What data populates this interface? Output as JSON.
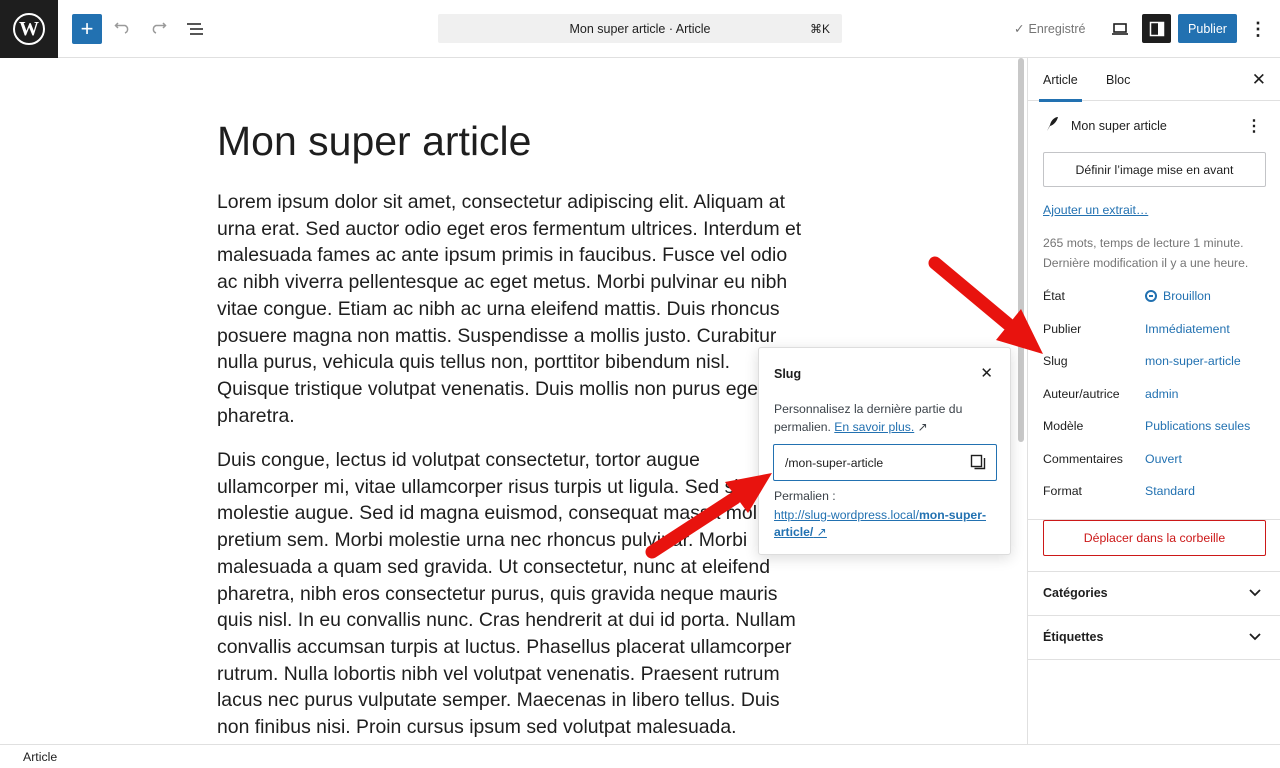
{
  "topbar": {
    "logo_letter": "W",
    "add_icon": "plus-icon",
    "undo_icon": "undo-icon",
    "redo_icon": "redo-icon",
    "outline_icon": "list-view-icon",
    "command_title": "Mon super article · Article",
    "command_shortcut": "⌘K",
    "saved_label": "Enregistré",
    "publish_label": "Publier"
  },
  "editor": {
    "title": "Mon super article",
    "paragraph1": "Lorem ipsum dolor sit amet, consectetur adipiscing elit. Aliquam at urna erat. Sed auctor odio eget eros fermentum ultrices. Interdum et malesuada fames ac ante ipsum primis in faucibus. Fusce vel odio ac nibh viverra pellentesque ac eget metus. Morbi pulvinar eu nibh vitae congue. Etiam ac nibh ac urna eleifend mattis. Duis rhoncus posuere magna non mattis. Suspendisse a mollis justo. Curabitur nulla purus, vehicula quis tellus non, porttitor bibendum nisl. Quisque tristique volutpat venenatis. Duis mollis non purus eget pharetra.",
    "paragraph2": "Duis congue, lectus id volutpat consectetur, tortor augue ullamcorper mi, vitae ullamcorper risus turpis ut ligula. Sed sit molestie augue. Sed id magna euismod, consequat massa mollis pretium sem. Morbi molestie urna nec rhoncus pulvinar. Morbi malesuada a quam sed gravida. Ut consectetur, nunc at eleifend pharetra, nibh eros consectetur purus, quis gravida neque mauris quis nisl. In eu convallis nunc. Cras hendrerit at dui id porta. Nullam convallis accumsan turpis at luctus. Phasellus placerat ullamcorper rutrum. Nulla lobortis nibh vel volutpat venenatis. Praesent rutrum lacus nec purus vulputate semper. Maecenas in libero tellus. Duis non finibus nisi. Proin cursus ipsum sed volutpat malesuada."
  },
  "sidebar": {
    "tab_article": "Article",
    "tab_bloc": "Bloc",
    "post_title": "Mon super article",
    "featured_image_button": "Définir l’image mise en avant",
    "excerpt_link": "Ajouter un extrait…",
    "meta_line1": "265 mots, temps de lecture 1 minute.",
    "meta_line2": "Dernière modification il y a une heure.",
    "rows": [
      {
        "label": "État",
        "value": "Brouillon"
      },
      {
        "label": "Publier",
        "value": "Immédiatement"
      },
      {
        "label": "Slug",
        "value": "mon-super-article"
      },
      {
        "label": "Auteur/autrice",
        "value": "admin"
      },
      {
        "label": "Modèle",
        "value": "Publications seules"
      },
      {
        "label": "Commentaires",
        "value": "Ouvert"
      },
      {
        "label": "Format",
        "value": "Standard"
      }
    ],
    "trash_button": "Déplacer dans la corbeille",
    "panels": [
      {
        "title": "Catégories"
      },
      {
        "title": "Étiquettes"
      }
    ]
  },
  "slug_popover": {
    "title": "Slug",
    "description": "Personnalisez la dernière partie du permalien.",
    "learn_more": "En savoir plus.",
    "input_value": "/mon-super-article",
    "permalink_label": "Permalien :",
    "permalink_base": "http://slug-wordpress.local/",
    "permalink_slug": "mon-super-article/"
  },
  "statusbar": {
    "breadcrumb": "Article"
  },
  "colors": {
    "accent": "#2271b1",
    "danger": "#cc1818",
    "annotation_arrow": "#e8130e"
  }
}
